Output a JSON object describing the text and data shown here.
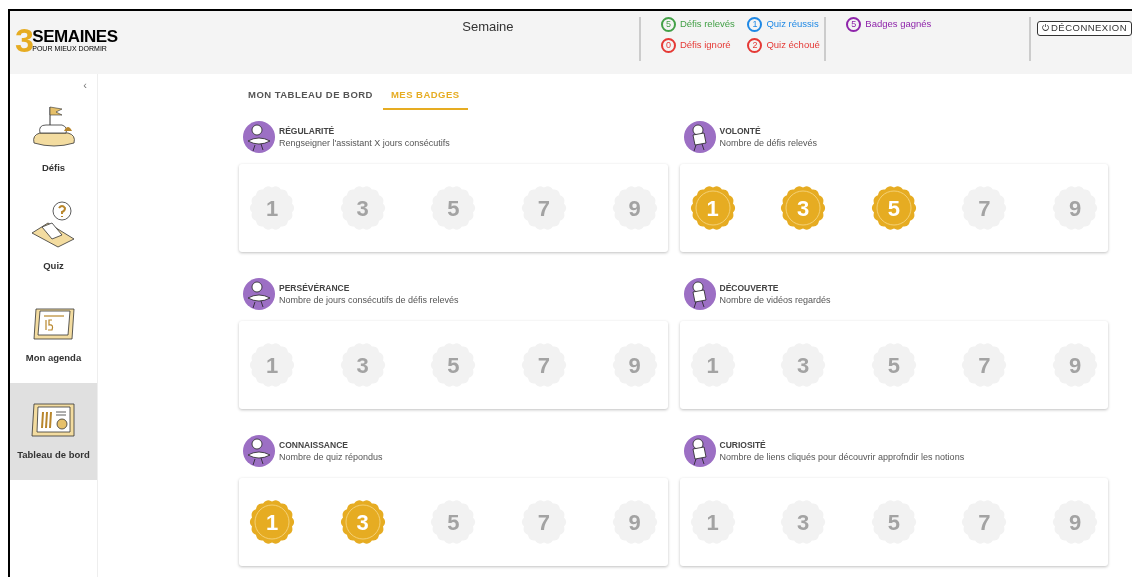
{
  "logo": {
    "number": "3",
    "title": "SEMAINES",
    "subtitle": "POUR MIEUX DORMIR"
  },
  "header": {
    "period": "Semaine",
    "stats": [
      {
        "count": "5",
        "label": "Défis relevés",
        "color": "#43a047"
      },
      {
        "count": "1",
        "label": "Quiz réussis",
        "color": "#1e88e5"
      },
      {
        "count": "0",
        "label": "Défis ignoré",
        "color": "#e53935"
      },
      {
        "count": "2",
        "label": "Quiz échoué",
        "color": "#e53935"
      }
    ],
    "badges_stat": {
      "count": "5",
      "label": "Badges gagnés",
      "color": "#8e24aa"
    },
    "logout": {
      "icon": "⏻",
      "label": "DÉCONNEXION"
    }
  },
  "sidebar": {
    "collapse": "‹",
    "items": [
      {
        "kind": "flag",
        "label": "Défis",
        "selected": false
      },
      {
        "kind": "quiz",
        "label": "Quiz",
        "selected": false
      },
      {
        "kind": "agenda",
        "label": "Mon agenda",
        "selected": false
      },
      {
        "kind": "dashboard",
        "label": "Tableau de bord",
        "selected": true
      }
    ]
  },
  "tabs": [
    {
      "label": "MON TABLEAU DE BORD",
      "selected": false
    },
    {
      "label": "MES BADGES",
      "selected": true
    }
  ],
  "categories": [
    {
      "title": "RÉGULARITÉ",
      "description": "Rengseigner l'assistant X jours consécutifs",
      "badges": [
        {
          "value": "1",
          "earned": false
        },
        {
          "value": "3",
          "earned": false
        },
        {
          "value": "5",
          "earned": false
        },
        {
          "value": "7",
          "earned": false
        },
        {
          "value": "9",
          "earned": false
        }
      ]
    },
    {
      "title": "VOLONTÉ",
      "description": "Nombre de défis relevés",
      "badges": [
        {
          "value": "1",
          "earned": true
        },
        {
          "value": "3",
          "earned": true
        },
        {
          "value": "5",
          "earned": true
        },
        {
          "value": "7",
          "earned": false
        },
        {
          "value": "9",
          "earned": false
        }
      ]
    },
    {
      "title": "PERSÉVÉRANCE",
      "description": "Nombre de jours consécutifs de défis relevés",
      "badges": [
        {
          "value": "1",
          "earned": false
        },
        {
          "value": "3",
          "earned": false
        },
        {
          "value": "5",
          "earned": false
        },
        {
          "value": "7",
          "earned": false
        },
        {
          "value": "9",
          "earned": false
        }
      ]
    },
    {
      "title": "DÉCOUVERTE",
      "description": "Nombre de vidéos regardés",
      "badges": [
        {
          "value": "1",
          "earned": false
        },
        {
          "value": "3",
          "earned": false
        },
        {
          "value": "5",
          "earned": false
        },
        {
          "value": "7",
          "earned": false
        },
        {
          "value": "9",
          "earned": false
        }
      ]
    },
    {
      "title": "CONNAISSANCE",
      "description": "Nombre de quiz répondus",
      "badges": [
        {
          "value": "1",
          "earned": true
        },
        {
          "value": "3",
          "earned": true
        },
        {
          "value": "5",
          "earned": false
        },
        {
          "value": "7",
          "earned": false
        },
        {
          "value": "9",
          "earned": false
        }
      ]
    },
    {
      "title": "CURIOSITÉ",
      "description": "Nombre de liens cliqués pour découvrir approfndir les notions",
      "badges": [
        {
          "value": "1",
          "earned": false
        },
        {
          "value": "3",
          "earned": false
        },
        {
          "value": "5",
          "earned": false
        },
        {
          "value": "7",
          "earned": false
        },
        {
          "value": "9",
          "earned": false
        }
      ]
    }
  ]
}
